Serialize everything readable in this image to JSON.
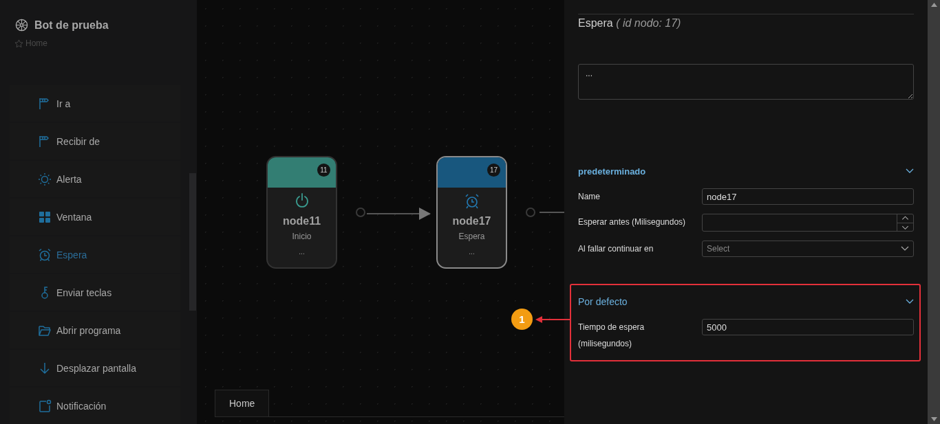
{
  "app": {
    "title": "Bot de prueba",
    "breadcrumb": "Home"
  },
  "sidebar": {
    "items": [
      {
        "label": "Ir a",
        "selected": false
      },
      {
        "label": "Recibir de",
        "selected": false
      },
      {
        "label": "Alerta",
        "selected": false
      },
      {
        "label": "Ventana",
        "selected": false
      },
      {
        "label": "Espera",
        "selected": true
      },
      {
        "label": "Enviar teclas",
        "selected": false
      },
      {
        "label": "Abrir programa",
        "selected": false
      },
      {
        "label": "Desplazar pantalla",
        "selected": false
      },
      {
        "label": "Notificación",
        "selected": false
      }
    ]
  },
  "canvas": {
    "nodes": [
      {
        "badge": "11",
        "name": "node11",
        "type": "Inicio",
        "note": "...",
        "color": "#337e73",
        "selected": false
      },
      {
        "badge": "17",
        "name": "node17",
        "type": "Espera",
        "note": "...",
        "color": "#18577e",
        "selected": true
      }
    ],
    "tabs": [
      {
        "label": "Home",
        "selected": true
      }
    ]
  },
  "panel": {
    "title": "Espera",
    "subtitle": "( id nodo: 17)",
    "description": "...",
    "sections": [
      {
        "title": "predeterminado",
        "expanded": true,
        "highlighted": false,
        "fields": [
          {
            "kind": "text",
            "label": "Name",
            "value": "node17"
          },
          {
            "kind": "number",
            "label": "Esperar antes (Milisegundos)"
          },
          {
            "kind": "select",
            "label": "Al fallar continuar en",
            "placeholder": "Select"
          }
        ]
      },
      {
        "title": "Por defecto",
        "expanded": true,
        "highlighted": true,
        "annotation": "1",
        "fields": [
          {
            "kind": "text",
            "label": "Tiempo de espera (milisegundos)",
            "value": "5000"
          }
        ]
      }
    ]
  }
}
